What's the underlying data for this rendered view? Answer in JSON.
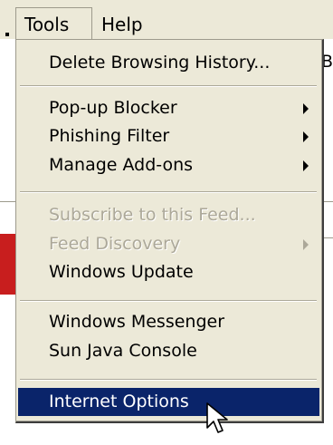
{
  "menubar": {
    "tools_label": "Tools",
    "help_label": "Help"
  },
  "background": {
    "right_fragment": "Bo"
  },
  "menu": {
    "items": [
      {
        "label": "Delete Browsing History..."
      },
      {
        "label": "Pop-up Blocker",
        "submenu": true
      },
      {
        "label": "Phishing Filter",
        "submenu": true
      },
      {
        "label": "Manage Add-ons",
        "submenu": true
      },
      {
        "label": "Subscribe to this Feed...",
        "disabled": true
      },
      {
        "label": "Feed Discovery",
        "disabled": true,
        "submenu": true
      },
      {
        "label": "Windows Update"
      },
      {
        "label": "Windows Messenger"
      },
      {
        "label": "Sun Java Console"
      },
      {
        "label": "Internet Options",
        "selected": true
      }
    ]
  },
  "colors": {
    "menu_background": "#ece9d8",
    "selection_background": "#0a246a",
    "disabled_text": "#aca899"
  },
  "icons": [
    "submenu-arrow-icon",
    "mouse-pointer-icon"
  ]
}
